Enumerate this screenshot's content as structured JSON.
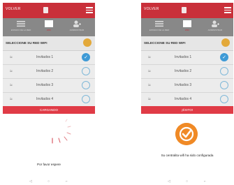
{
  "colors": {
    "accent": "#c9303a",
    "bar": "#e03b46",
    "checked": "#3e9ad6",
    "success": "#f08a26",
    "tabs": "#888888"
  },
  "left": {
    "back_label": "VOLVER",
    "tabs": [
      {
        "icon": "list-icon",
        "label": "ESTADO DE LA RED"
      },
      {
        "icon": "wifi-icon",
        "label": "WIFI"
      },
      {
        "icon": "user-add-icon",
        "label": "ADMINISTRAR"
      }
    ],
    "section_title": "SELECCIONE SU RED WIFI",
    "networks": [
      {
        "name": "Invitados 1",
        "checked": true
      },
      {
        "name": "Invitados 2",
        "checked": false
      },
      {
        "name": "Invitados 3",
        "checked": false
      },
      {
        "name": "Invitados 4",
        "checked": false
      }
    ],
    "status_bar": "CARGANDO",
    "message": "Por favor espere"
  },
  "right": {
    "back_label": "VOLVER",
    "tabs": [
      {
        "icon": "list-icon",
        "label": "ESTADO DE LA RED"
      },
      {
        "icon": "wifi-icon",
        "label": "WIFI"
      },
      {
        "icon": "user-add-icon",
        "label": "ADMINISTRAR"
      }
    ],
    "section_title": "SELECCIONE SU RED WIFI",
    "networks": [
      {
        "name": "Invitados 1",
        "checked": true
      },
      {
        "name": "Invitados 2",
        "checked": false
      },
      {
        "name": "Invitados 3",
        "checked": false
      },
      {
        "name": "Invitados 4",
        "checked": false
      }
    ],
    "status_bar": "¡ÉXITO!",
    "message": "Su centralita wifi ha sido configurada"
  },
  "nav_icons": [
    "back-nav-icon",
    "home-nav-icon",
    "recent-apps-icon"
  ]
}
